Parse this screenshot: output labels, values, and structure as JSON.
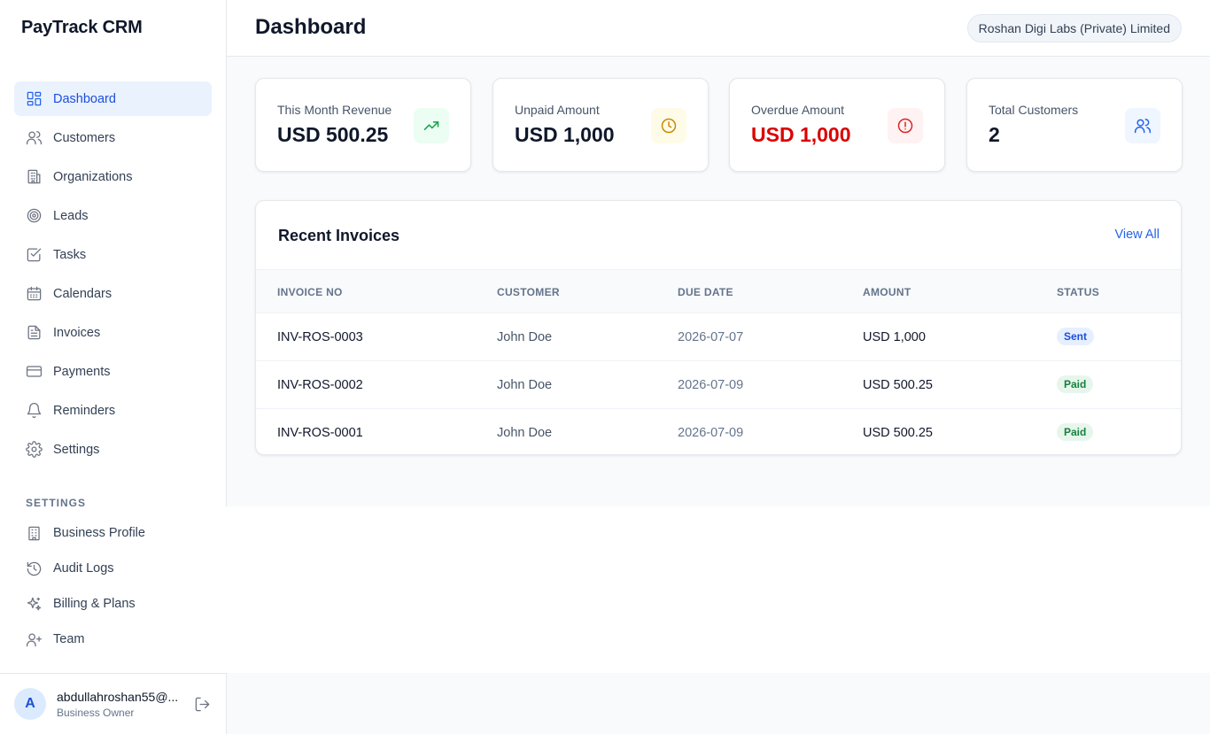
{
  "app": {
    "brand": "PayTrack CRM"
  },
  "sidebar": {
    "items": [
      {
        "label": "Dashboard",
        "icon": "dashboard-icon",
        "active": true
      },
      {
        "label": "Customers",
        "icon": "users-icon"
      },
      {
        "label": "Organizations",
        "icon": "building-icon"
      },
      {
        "label": "Leads",
        "icon": "target-icon"
      },
      {
        "label": "Tasks",
        "icon": "checkbox-icon"
      },
      {
        "label": "Calendars",
        "icon": "calendar-icon"
      },
      {
        "label": "Invoices",
        "icon": "file-icon"
      },
      {
        "label": "Payments",
        "icon": "card-icon"
      },
      {
        "label": "Reminders",
        "icon": "bell-icon"
      },
      {
        "label": "Settings",
        "icon": "gear-icon"
      }
    ],
    "settings_label": "SETTINGS",
    "settings_items": [
      {
        "label": "Business Profile",
        "icon": "office-icon"
      },
      {
        "label": "Audit Logs",
        "icon": "history-icon"
      },
      {
        "label": "Billing & Plans",
        "icon": "sparkles-icon"
      },
      {
        "label": "Team",
        "icon": "user-plus-icon"
      }
    ]
  },
  "user": {
    "initial": "A",
    "email": "abdullahroshan55@...",
    "role": "Business Owner"
  },
  "header": {
    "title": "Dashboard",
    "organization": "Roshan Digi Labs (Private) Limited"
  },
  "stats": [
    {
      "label": "This Month Revenue",
      "value": "USD 500.25",
      "icon": "trending-up-icon",
      "icon_color": "#16a34a",
      "icon_bg": "#ecfdf3"
    },
    {
      "label": "Unpaid Amount",
      "value": "USD 1,000",
      "icon": "clock-icon",
      "icon_color": "#ca8a04",
      "icon_bg": "#fefce8"
    },
    {
      "label": "Overdue Amount",
      "value": "USD 1,000",
      "icon": "alert-circle-icon",
      "icon_color": "#dc2626",
      "icon_bg": "#fef2f2",
      "value_color": "#dc0000"
    },
    {
      "label": "Total Customers",
      "value": "2",
      "icon": "users-icon",
      "icon_color": "#2563eb",
      "icon_bg": "#eff6ff"
    }
  ],
  "invoices": {
    "title": "Recent Invoices",
    "view_all": "View All",
    "columns": [
      "INVOICE NO",
      "CUSTOMER",
      "DUE DATE",
      "AMOUNT",
      "STATUS"
    ],
    "rows": [
      {
        "invoice_no": "INV-ROS-0003",
        "customer": "John Doe",
        "due_date": "2026-07-07",
        "amount": "USD 1,000",
        "status": "Sent"
      },
      {
        "invoice_no": "INV-ROS-0002",
        "customer": "John Doe",
        "due_date": "2026-07-09",
        "amount": "USD 500.25",
        "status": "Paid"
      },
      {
        "invoice_no": "INV-ROS-0001",
        "customer": "John Doe",
        "due_date": "2026-07-09",
        "amount": "USD 500.25",
        "status": "Paid"
      }
    ]
  },
  "colors": {
    "accent": "#2563eb",
    "danger": "#dc0000",
    "success": "#15803d"
  }
}
